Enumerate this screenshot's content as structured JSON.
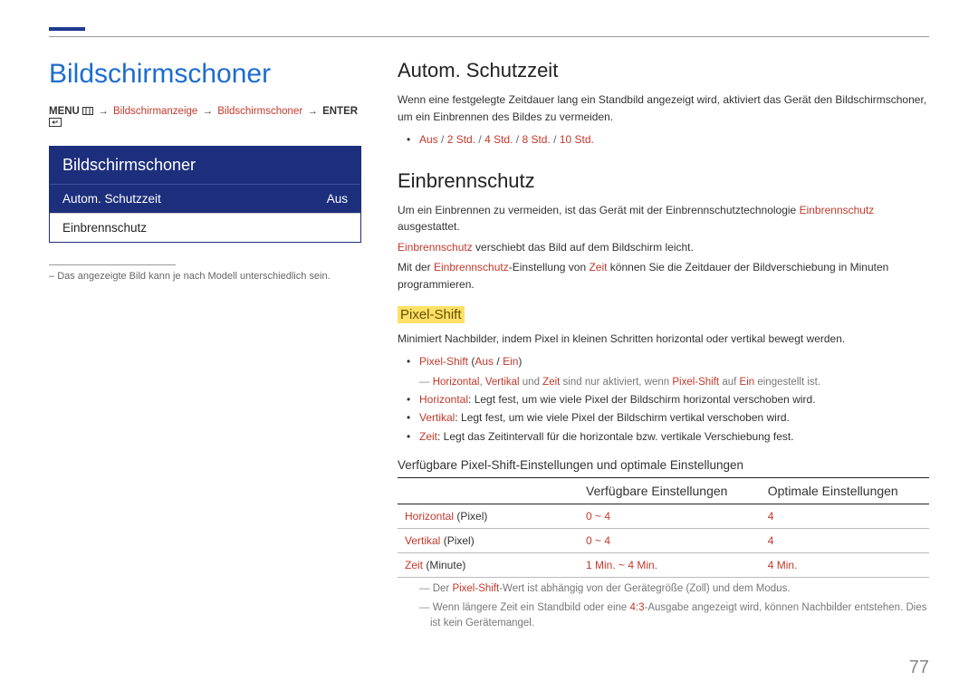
{
  "page_number": "77",
  "left": {
    "title": "Bildschirmschoner",
    "breadcrumb": {
      "menu": "MENU",
      "p1": "Bildschirmanzeige",
      "p2": "Bildschirmschoner",
      "enter": "ENTER"
    },
    "menu": {
      "header": "Bildschirmschoner",
      "row1_label": "Autom. Schutzzeit",
      "row1_value": "Aus",
      "row2_label": "Einbrennschutz"
    },
    "footnote": "Das angezeigte Bild kann je nach Modell unterschiedlich sein."
  },
  "right": {
    "sec1": {
      "title": "Autom. Schutzzeit",
      "body": "Wenn eine festgelegte Zeitdauer lang ein Standbild angezeigt wird, aktiviert das Gerät den Bildschirmschoner, um ein Einbrennen des Bildes zu vermeiden.",
      "opts": {
        "a": "Aus",
        "b": "2 Std.",
        "c": "4 Std.",
        "d": "8 Std.",
        "e": "10 Std."
      }
    },
    "sec2": {
      "title": "Einbrennschutz",
      "p1a": "Um ein Einbrennen zu vermeiden, ist das Gerät mit der Einbrennschutztechnologie ",
      "p1b": "Einbrennschutz",
      "p1c": " ausgestattet.",
      "p2a": "Einbrennschutz",
      "p2b": " verschiebt das Bild auf dem Bildschirm leicht.",
      "p3a": "Mit der ",
      "p3b": "Einbrennschutz",
      "p3c": "-Einstellung von ",
      "p3d": "Zeit",
      "p3e": " können Sie die Zeitdauer der Bildverschiebung in Minuten programmieren."
    },
    "pixel": {
      "heading": "Pixel-Shift",
      "intro": "Minimiert Nachbilder, indem Pixel in kleinen Schritten horizontal oder vertikal bewegt werden.",
      "li1": {
        "a": "Pixel-Shift",
        "b": "Aus",
        "c": "Ein"
      },
      "note1": {
        "a": "Horizontal",
        "b": "Vertikal",
        "c": "Zeit",
        "mid1": " sind nur aktiviert, wenn ",
        "d": "Pixel-Shift",
        "mid2": " auf ",
        "e": "Ein",
        "tail": " eingestellt ist.",
        "und": " und "
      },
      "li2": {
        "a": "Horizontal",
        "b": ": Legt fest, um wie viele Pixel der Bildschirm horizontal verschoben wird."
      },
      "li3": {
        "a": "Vertikal",
        "b": ": Legt fest, um wie viele Pixel der Bildschirm vertikal verschoben wird."
      },
      "li4": {
        "a": "Zeit",
        "b": ": Legt das Zeitintervall für die horizontale bzw. vertikale Verschiebung fest."
      },
      "table_title": "Verfügbare Pixel-Shift-Einstellungen und optimale Einstellungen",
      "th1": "",
      "th2": "Verfügbare Einstellungen",
      "th3": "Optimale Einstellungen"
    },
    "foot1": {
      "a": "Der ",
      "b": "Pixel-Shift",
      "c": "-Wert ist abhängig von der Gerätegröße (Zoll) und dem Modus."
    },
    "foot2": {
      "a": "Wenn längere Zeit ein Standbild oder eine ",
      "b": "4:3",
      "c": "-Ausgabe angezeigt wird, können Nachbilder entstehen. Dies ist kein Gerätemangel."
    }
  },
  "chart_data": {
    "type": "table",
    "title": "Verfügbare Pixel-Shift-Einstellungen und optimale Einstellungen",
    "columns": [
      "",
      "Verfügbare Einstellungen",
      "Optimale Einstellungen"
    ],
    "rows": [
      {
        "label_key": "Horizontal",
        "label_unit": " (Pixel)",
        "range": "0 ~ 4",
        "optimal": "4"
      },
      {
        "label_key": "Vertikal",
        "label_unit": " (Pixel)",
        "range": "0 ~ 4",
        "optimal": "4"
      },
      {
        "label_key": "Zeit",
        "label_unit": " (Minute)",
        "range": "1 Min. ~ 4 Min.",
        "optimal": "4 Min."
      }
    ]
  }
}
